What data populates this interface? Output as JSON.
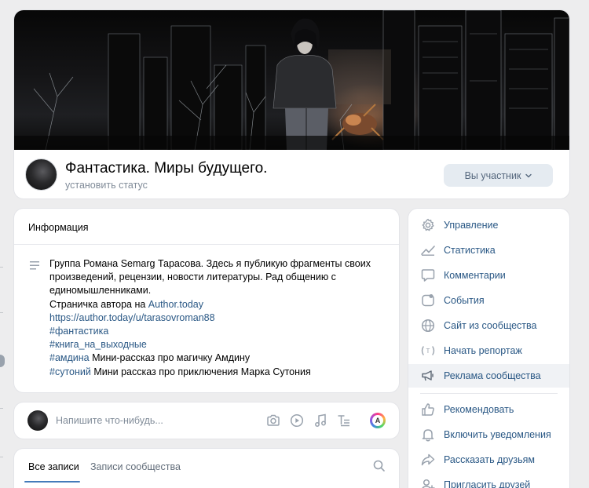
{
  "group": {
    "title": "Фантастика. Миры будущего.",
    "status": "установить статус",
    "member_button": "Вы участник"
  },
  "info": {
    "header": "Информация",
    "description": "Группа Романа Semarg Тарасова. Здесь я публикую фрагменты своих произведений, рецензии, новости литературы. Рад общению с единомышленниками.",
    "author_prefix": "Страничка автора на ",
    "author_link": "Author.today",
    "author_url": "https://author.today/u/tarasovroman88",
    "tag1": "#фантастика",
    "tag2": "#книга_на_выходные",
    "tag3": "#амдина",
    "tag3_text": " Мини-рассказ про магичку Амдину",
    "tag4": "#сутоний",
    "tag4_text": " Мини рассказ про приключения Марка Сутония"
  },
  "post": {
    "placeholder": "Напишите что-нибудь..."
  },
  "tabs": {
    "all": "Все записи",
    "community": "Записи сообщества"
  },
  "menu": {
    "items": [
      {
        "label": "Управление",
        "icon": "gear-icon"
      },
      {
        "label": "Статистика",
        "icon": "chart-icon"
      },
      {
        "label": "Комментарии",
        "icon": "comment-icon"
      },
      {
        "label": "События",
        "icon": "event-icon"
      },
      {
        "label": "Сайт из сообщества",
        "icon": "globe-icon"
      },
      {
        "label": "Начать репортаж",
        "icon": "broadcast-icon"
      },
      {
        "label": "Реклама сообщества",
        "icon": "megaphone-icon"
      },
      {
        "label": "Рекомендовать",
        "icon": "like-icon"
      },
      {
        "label": "Включить уведомления",
        "icon": "bell-icon"
      },
      {
        "label": "Рассказать друзьям",
        "icon": "share-icon"
      },
      {
        "label": "Пригласить друзей",
        "icon": "add-user-icon"
      }
    ]
  },
  "colors": {
    "link": "#2a5885",
    "accent": "#447bba",
    "background": "#ededee"
  }
}
